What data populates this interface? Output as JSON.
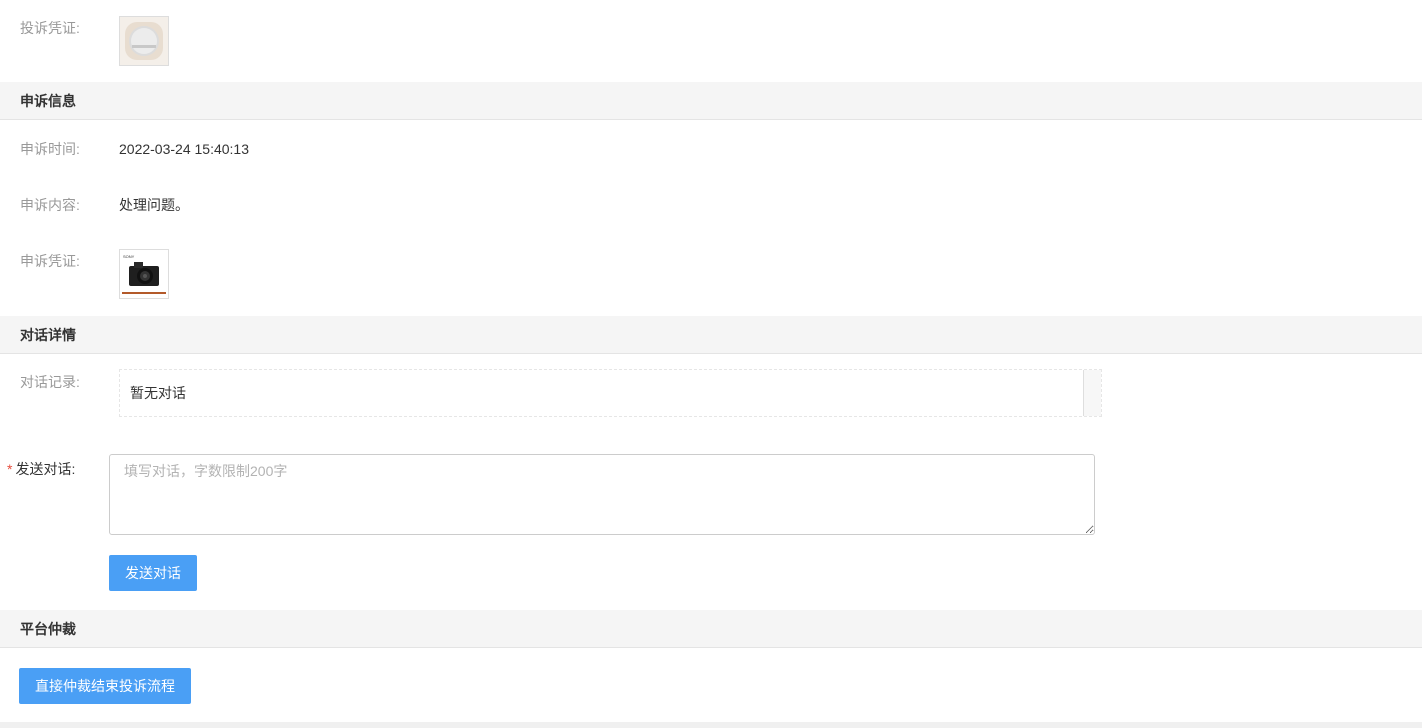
{
  "complaint": {
    "evidence_label": "投诉凭证:",
    "evidence_image_icon": "speaker-product-thumbnail"
  },
  "appeal": {
    "section_title": "申诉信息",
    "time_label": "申诉时间:",
    "time_value": "2022-03-24 15:40:13",
    "content_label": "申诉内容:",
    "content_value": "处理问题。",
    "evidence_label": "申诉凭证:",
    "evidence_image_icon": "camera-product-thumbnail",
    "evidence_brand_text": "SONY"
  },
  "dialog": {
    "section_title": "对话详情",
    "record_label": "对话记录:",
    "record_empty_text": "暂无对话",
    "send_label_required": "*",
    "send_label": "发送对话:",
    "input_placeholder": "填写对话，字数限制200字",
    "input_value": "",
    "send_button_label": "发送对话"
  },
  "arbitration": {
    "section_title": "平台仲裁",
    "button_label": "直接仲裁结束投诉流程"
  },
  "colors": {
    "primary_button": "#4a9ff5",
    "section_bg": "#f5f5f5",
    "label_gray": "#999999",
    "required_red": "#e74c3c"
  }
}
